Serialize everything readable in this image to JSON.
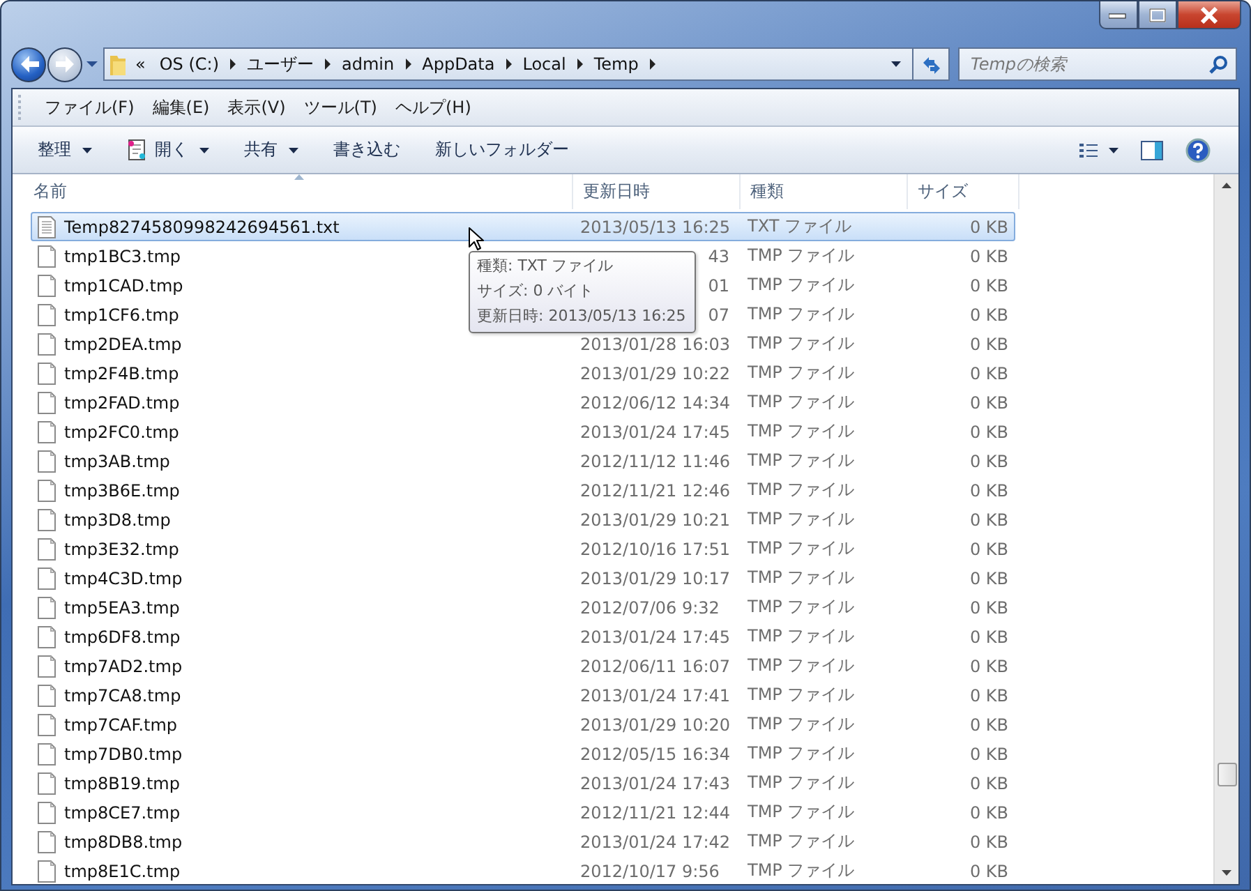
{
  "navigation": {
    "back_disabled": false,
    "forward_disabled": true
  },
  "address": {
    "overflow": "«",
    "crumbs": [
      "OS (C:)",
      "ユーザー",
      "admin",
      "AppData",
      "Local",
      "Temp"
    ]
  },
  "search": {
    "placeholder": "Tempの検索"
  },
  "menu": [
    "ファイル(F)",
    "編集(E)",
    "表示(V)",
    "ツール(T)",
    "ヘルプ(H)"
  ],
  "commands": [
    {
      "label": "整理",
      "dropdown": true,
      "has_icon": false
    },
    {
      "label": "開く",
      "dropdown": true,
      "has_icon": true
    },
    {
      "label": "共有",
      "dropdown": true,
      "has_icon": false
    },
    {
      "label": "書き込む",
      "dropdown": false,
      "has_icon": false
    },
    {
      "label": "新しいフォルダー",
      "dropdown": false,
      "has_icon": false
    }
  ],
  "columns": [
    {
      "label": "名前",
      "sorted": true
    },
    {
      "label": "更新日時",
      "sorted": false
    },
    {
      "label": "種類",
      "sorted": false
    },
    {
      "label": "サイズ",
      "sorted": false
    }
  ],
  "rows": [
    {
      "kind": "text",
      "name": "Temp8274580998242694561.txt",
      "date": "2013/05/13 16:25",
      "date_cut": false,
      "type": "TXT ファイル",
      "size": "0 KB",
      "selected": true
    },
    {
      "kind": "blank",
      "name": "tmp1BC3.tmp",
      "date": "43",
      "date_cut": true,
      "type": "TMP ファイル",
      "size": "0 KB",
      "selected": false
    },
    {
      "kind": "blank",
      "name": "tmp1CAD.tmp",
      "date": "01",
      "date_cut": true,
      "type": "TMP ファイル",
      "size": "0 KB",
      "selected": false
    },
    {
      "kind": "blank",
      "name": "tmp1CF6.tmp",
      "date": "07",
      "date_cut": true,
      "type": "TMP ファイル",
      "size": "0 KB",
      "selected": false
    },
    {
      "kind": "blank",
      "name": "tmp2DEA.tmp",
      "date": "2013/01/28 16:03",
      "date_cut": false,
      "type": "TMP ファイル",
      "size": "0 KB",
      "selected": false
    },
    {
      "kind": "blank",
      "name": "tmp2F4B.tmp",
      "date": "2013/01/29 10:22",
      "date_cut": false,
      "type": "TMP ファイル",
      "size": "0 KB",
      "selected": false
    },
    {
      "kind": "blank",
      "name": "tmp2FAD.tmp",
      "date": "2012/06/12 14:34",
      "date_cut": false,
      "type": "TMP ファイル",
      "size": "0 KB",
      "selected": false
    },
    {
      "kind": "blank",
      "name": "tmp2FC0.tmp",
      "date": "2013/01/24 17:45",
      "date_cut": false,
      "type": "TMP ファイル",
      "size": "0 KB",
      "selected": false
    },
    {
      "kind": "blank",
      "name": "tmp3AB.tmp",
      "date": "2012/11/12 11:46",
      "date_cut": false,
      "type": "TMP ファイル",
      "size": "0 KB",
      "selected": false
    },
    {
      "kind": "blank",
      "name": "tmp3B6E.tmp",
      "date": "2012/11/21 12:46",
      "date_cut": false,
      "type": "TMP ファイル",
      "size": "0 KB",
      "selected": false
    },
    {
      "kind": "blank",
      "name": "tmp3D8.tmp",
      "date": "2013/01/29 10:21",
      "date_cut": false,
      "type": "TMP ファイル",
      "size": "0 KB",
      "selected": false
    },
    {
      "kind": "blank",
      "name": "tmp3E32.tmp",
      "date": "2012/10/16 17:51",
      "date_cut": false,
      "type": "TMP ファイル",
      "size": "0 KB",
      "selected": false
    },
    {
      "kind": "blank",
      "name": "tmp4C3D.tmp",
      "date": "2013/01/29 10:17",
      "date_cut": false,
      "type": "TMP ファイル",
      "size": "0 KB",
      "selected": false
    },
    {
      "kind": "blank",
      "name": "tmp5EA3.tmp",
      "date": "2012/07/06 9:32",
      "date_cut": false,
      "type": "TMP ファイル",
      "size": "0 KB",
      "selected": false
    },
    {
      "kind": "blank",
      "name": "tmp6DF8.tmp",
      "date": "2013/01/24 17:45",
      "date_cut": false,
      "type": "TMP ファイル",
      "size": "0 KB",
      "selected": false
    },
    {
      "kind": "blank",
      "name": "tmp7AD2.tmp",
      "date": "2012/06/11 16:07",
      "date_cut": false,
      "type": "TMP ファイル",
      "size": "0 KB",
      "selected": false
    },
    {
      "kind": "blank",
      "name": "tmp7CA8.tmp",
      "date": "2013/01/24 17:41",
      "date_cut": false,
      "type": "TMP ファイル",
      "size": "0 KB",
      "selected": false
    },
    {
      "kind": "blank",
      "name": "tmp7CAF.tmp",
      "date": "2013/01/29 10:20",
      "date_cut": false,
      "type": "TMP ファイル",
      "size": "0 KB",
      "selected": false
    },
    {
      "kind": "blank",
      "name": "tmp7DB0.tmp",
      "date": "2012/05/15 16:34",
      "date_cut": false,
      "type": "TMP ファイル",
      "size": "0 KB",
      "selected": false
    },
    {
      "kind": "blank",
      "name": "tmp8B19.tmp",
      "date": "2013/01/24 17:43",
      "date_cut": false,
      "type": "TMP ファイル",
      "size": "0 KB",
      "selected": false
    },
    {
      "kind": "blank",
      "name": "tmp8CE7.tmp",
      "date": "2012/11/21 12:44",
      "date_cut": false,
      "type": "TMP ファイル",
      "size": "0 KB",
      "selected": false
    },
    {
      "kind": "blank",
      "name": "tmp8DB8.tmp",
      "date": "2013/01/24 17:42",
      "date_cut": false,
      "type": "TMP ファイル",
      "size": "0 KB",
      "selected": false
    },
    {
      "kind": "blank",
      "name": "tmp8E1C.tmp",
      "date": "2012/10/17 9:56",
      "date_cut": false,
      "type": "TMP ファイル",
      "size": "0 KB",
      "selected": false
    }
  ],
  "tooltip": {
    "lines": [
      "種類: TXT ファイル",
      "サイズ: 0 バイト",
      "更新日時: 2013/05/13 16:25"
    ]
  }
}
